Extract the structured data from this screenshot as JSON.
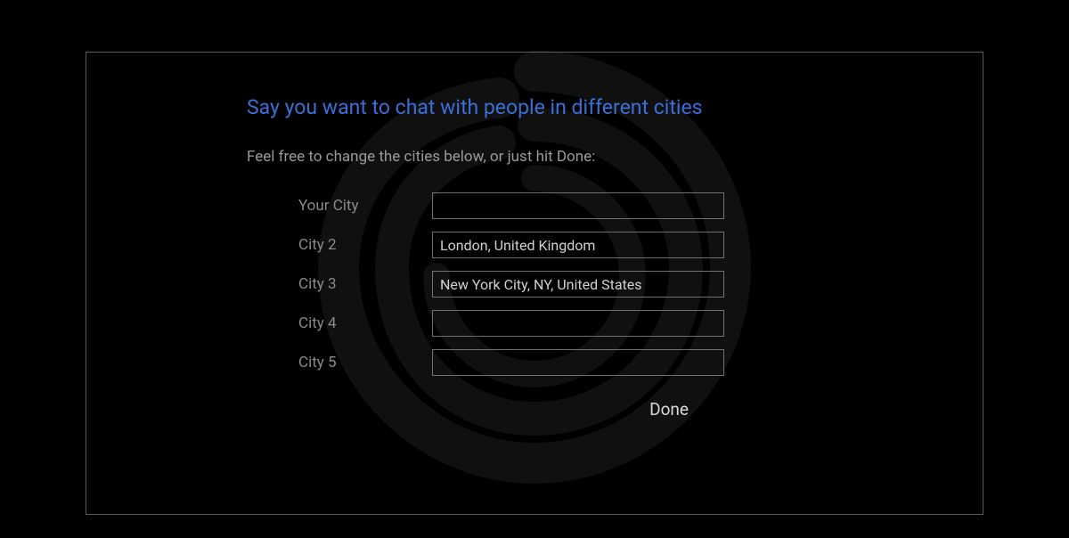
{
  "dialog": {
    "title": "Say you want to chat with people in different cities",
    "subtitle": "Feel free to change the cities below, or just hit Done:",
    "fields": [
      {
        "label": "Your City",
        "value": ""
      },
      {
        "label": "City 2",
        "value": "London, United Kingdom"
      },
      {
        "label": "City 3",
        "value": "New York City, NY, United States"
      },
      {
        "label": "City 4",
        "value": ""
      },
      {
        "label": "City 5",
        "value": ""
      }
    ],
    "done_label": "Done"
  }
}
